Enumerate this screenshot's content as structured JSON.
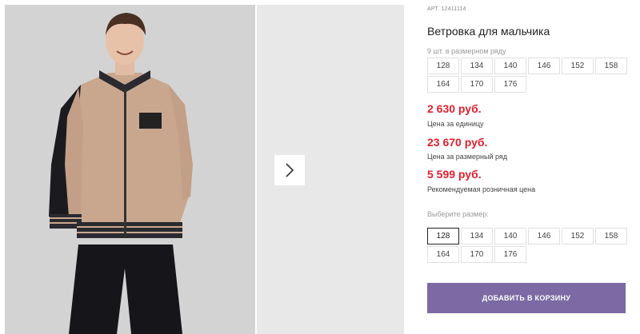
{
  "product": {
    "article": "АРТ. 12411114",
    "title": "Ветровка для мальчика",
    "row_label": "9 шт. в размерном ряду",
    "row_sizes": [
      "128",
      "134",
      "140",
      "146",
      "152",
      "158",
      "164",
      "170",
      "176"
    ],
    "prices": [
      {
        "value": "2 630 руб.",
        "note": "Цена за единицу"
      },
      {
        "value": "23 670 руб.",
        "note": "Цена за размерный ряд"
      },
      {
        "value": "5 599 руб.",
        "note": "Рекомендуемая розничная цена"
      }
    ],
    "choose_label": "Выберите размер:",
    "choose_sizes": [
      "128",
      "134",
      "140",
      "146",
      "152",
      "158",
      "164",
      "170",
      "176"
    ],
    "selected_size": "128",
    "add_to_cart": "ДОБАВИТЬ В КОРЗИНУ"
  },
  "gallery": {
    "next_icon": "chevron-right-icon",
    "photo": "boy-in-jacket-photo"
  },
  "colors": {
    "price": "#e0202f",
    "button": "#7b6aa3"
  }
}
